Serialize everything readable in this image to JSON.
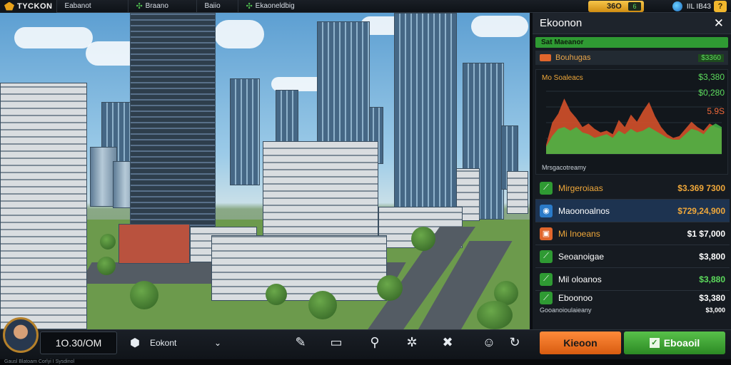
{
  "topbar": {
    "logo_text": "TYCKON",
    "tabs": [
      {
        "label": "Eabanot"
      },
      {
        "label": "Braano"
      },
      {
        "label": "Baiio"
      },
      {
        "label": "Ekaoneldbig"
      }
    ],
    "money": "36O",
    "money_indicator": "6",
    "player_text": "IIL  IB43",
    "help": "?"
  },
  "panel": {
    "title": "Ekoonon",
    "close": "✕",
    "green_header": "Sat  Maeanor",
    "orange_row": {
      "label": "Bouhugas",
      "value": "$3360"
    },
    "chart_title": "Mo Soaleacs",
    "chart_labels": [
      "$3,380",
      "$0,280",
      "5.9S"
    ],
    "chart_footer": "Mrsgacotreamy",
    "rows": [
      {
        "label": "Mirgeroiaas",
        "value": "$3.369 7300",
        "icon_color": "#2f9a33",
        "label_color": "#f0a83a"
      },
      {
        "label": "Maoonoalnos",
        "value": "$729,24,900",
        "icon_color": "#2a7ac8",
        "label_color": "#ffffff"
      },
      {
        "label": "Mi Inoeans",
        "value": "$1 $7,000",
        "icon_color": "#e0662c",
        "label_color": "#f0a83a"
      },
      {
        "label": "Seoanoigae",
        "value": "$3,800",
        "icon_color": "#2f9a33",
        "label_color": "#ffffff"
      },
      {
        "label": "Mil oloanos",
        "value": "$3,880",
        "icon_color": "#2f9a33",
        "label_color": "#ffffff"
      },
      {
        "label": "Eboonoo",
        "value": "$3,380",
        "icon_color": "#2f9a33",
        "label_color": "#ffffff"
      }
    ],
    "row_footer": {
      "label": "Gooanoioulaieany",
      "value": "$3,000"
    }
  },
  "bottom": {
    "cash": "1O.30/OM",
    "selector": "Eokont",
    "dropdown": "⌄",
    "btn_orange": "Kieoon",
    "btn_green": "Eboaoil"
  },
  "status_text": "Gausl Blatoam     Corlyi I   Sysdinol",
  "chart_data": {
    "type": "area",
    "series": [
      {
        "values": [
          10,
          35,
          45,
          62,
          48,
          40,
          30,
          34,
          28,
          24,
          26,
          22,
          38,
          30,
          44,
          36,
          48,
          58,
          42,
          30,
          22,
          18,
          20,
          28,
          36,
          30,
          26,
          34,
          30,
          28
        ],
        "color": "#d4502a"
      },
      {
        "values": [
          8,
          20,
          28,
          30,
          26,
          30,
          24,
          22,
          18,
          20,
          22,
          18,
          26,
          22,
          28,
          24,
          26,
          30,
          26,
          22,
          18,
          16,
          16,
          22,
          28,
          26,
          22,
          30,
          34,
          30
        ],
        "color": "#44b845"
      }
    ],
    "ylim": [
      0,
      70
    ]
  }
}
